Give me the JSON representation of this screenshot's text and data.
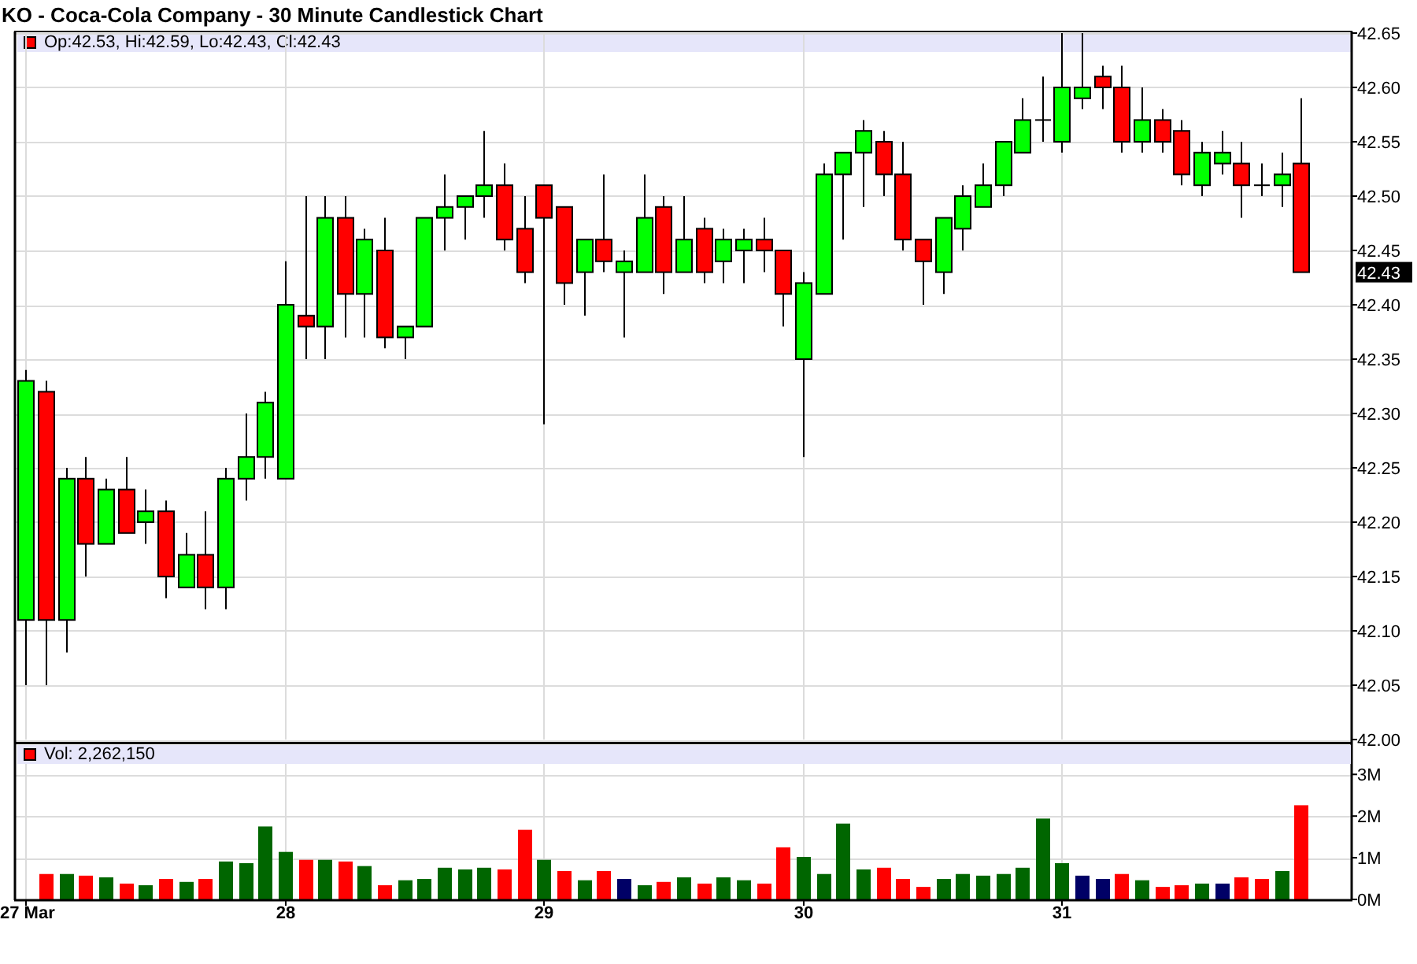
{
  "title": "KO - Coca-Cola Company - 30 Minute Candlestick Chart",
  "price_panel": {
    "legend": {
      "text": "Op:42.53, Hi:42.59, Lo:42.43, Cl:42.43",
      "color": "#ff0000"
    },
    "last_price": "42.43",
    "chart_data": {
      "type": "candlestick",
      "grid": true,
      "categories": [
        null,
        null,
        null,
        null,
        null,
        null,
        null,
        null,
        null,
        null,
        null,
        null,
        null,
        null,
        null,
        null,
        null,
        null,
        null,
        null,
        null,
        null,
        null,
        null,
        null,
        null,
        null,
        null,
        null,
        null,
        null,
        null,
        null,
        null,
        null,
        null,
        null,
        null,
        null,
        null,
        null,
        null,
        null,
        null,
        null,
        null,
        null,
        null,
        null,
        null,
        null,
        null,
        null,
        null,
        null,
        null,
        null,
        null,
        null,
        null,
        null,
        null,
        null,
        null,
        null,
        null,
        null
      ],
      "ylim": [
        42,
        42.65
      ],
      "yticks": [
        {
          "value": 42,
          "label": "42.00"
        },
        {
          "value": 42.05,
          "label": "42.05"
        },
        {
          "value": 42.1,
          "label": "42.10"
        },
        {
          "value": 42.15,
          "label": "42.15"
        },
        {
          "value": 42.2,
          "label": "42.20"
        },
        {
          "value": 42.25,
          "label": "42.25"
        },
        {
          "value": 42.3,
          "label": "42.30"
        },
        {
          "value": 42.35,
          "label": "42.35"
        },
        {
          "value": 42.4,
          "label": "42.40"
        },
        {
          "value": 42.45,
          "label": "42.45"
        },
        {
          "value": 42.5,
          "label": "42.50"
        },
        {
          "value": 42.55,
          "label": "42.55"
        },
        {
          "value": 42.6,
          "label": "42.60"
        },
        {
          "value": 42.65,
          "label": "42.65"
        }
      ],
      "ohlc": [
        [
          42.11,
          42.34,
          42.05,
          42.33
        ],
        [
          42.32,
          42.33,
          42.05,
          42.11
        ],
        [
          42.11,
          42.25,
          42.08,
          42.24
        ],
        [
          42.24,
          42.26,
          42.15,
          42.18
        ],
        [
          42.18,
          42.24,
          42.18,
          42.23
        ],
        [
          42.23,
          42.26,
          42.19,
          42.19
        ],
        [
          42.2,
          42.23,
          42.18,
          42.21
        ],
        [
          42.21,
          42.22,
          42.13,
          42.15
        ],
        [
          42.14,
          42.19,
          42.14,
          42.17
        ],
        [
          42.17,
          42.21,
          42.12,
          42.14
        ],
        [
          42.14,
          42.25,
          42.12,
          42.24
        ],
        [
          42.24,
          42.3,
          42.22,
          42.26
        ],
        [
          42.26,
          42.32,
          42.24,
          42.31
        ],
        [
          42.24,
          42.44,
          42.24,
          42.4
        ],
        [
          42.39,
          42.5,
          42.35,
          42.38
        ],
        [
          42.38,
          42.5,
          42.35,
          42.48
        ],
        [
          42.48,
          42.5,
          42.37,
          42.41
        ],
        [
          42.41,
          42.47,
          42.37,
          42.46
        ],
        [
          42.45,
          42.48,
          42.36,
          42.37
        ],
        [
          42.37,
          42.38,
          42.35,
          42.38
        ],
        [
          42.38,
          42.48,
          42.38,
          42.48
        ],
        [
          42.48,
          42.52,
          42.45,
          42.49
        ],
        [
          42.49,
          42.5,
          42.46,
          42.5
        ],
        [
          42.5,
          42.56,
          42.48,
          42.51
        ],
        [
          42.51,
          42.53,
          42.45,
          42.46
        ],
        [
          42.47,
          42.5,
          42.42,
          42.43
        ],
        [
          42.51,
          42.51,
          42.29,
          42.48
        ],
        [
          42.49,
          42.49,
          42.4,
          42.42
        ],
        [
          42.43,
          42.46,
          42.39,
          42.46
        ],
        [
          42.46,
          42.52,
          42.43,
          42.44
        ],
        [
          42.43,
          42.45,
          42.37,
          42.44
        ],
        [
          42.43,
          42.52,
          42.43,
          42.48
        ],
        [
          42.49,
          42.5,
          42.41,
          42.43
        ],
        [
          42.43,
          42.5,
          42.43,
          42.46
        ],
        [
          42.47,
          42.48,
          42.42,
          42.43
        ],
        [
          42.44,
          42.47,
          42.42,
          42.46
        ],
        [
          42.45,
          42.47,
          42.42,
          42.46
        ],
        [
          42.46,
          42.48,
          42.43,
          42.45
        ],
        [
          42.45,
          42.45,
          42.38,
          42.41
        ],
        [
          42.35,
          42.43,
          42.26,
          42.42
        ],
        [
          42.41,
          42.53,
          42.41,
          42.52
        ],
        [
          42.52,
          42.54,
          42.46,
          42.54
        ],
        [
          42.54,
          42.57,
          42.49,
          42.56
        ],
        [
          42.55,
          42.56,
          42.5,
          42.52
        ],
        [
          42.52,
          42.55,
          42.45,
          42.46
        ],
        [
          42.46,
          42.46,
          42.4,
          42.44
        ],
        [
          42.43,
          42.48,
          42.41,
          42.48
        ],
        [
          42.47,
          42.51,
          42.45,
          42.5
        ],
        [
          42.49,
          42.53,
          42.49,
          42.51
        ],
        [
          42.51,
          42.55,
          42.5,
          42.55
        ],
        [
          42.54,
          42.59,
          42.54,
          42.57
        ],
        [
          42.57,
          42.61,
          42.55,
          42.57
        ],
        [
          42.55,
          42.65,
          42.54,
          42.6
        ],
        [
          42.59,
          42.65,
          42.58,
          42.6
        ],
        [
          42.61,
          42.62,
          42.58,
          42.6
        ],
        [
          42.6,
          42.62,
          42.54,
          42.55
        ],
        [
          42.55,
          42.6,
          42.54,
          42.57
        ],
        [
          42.57,
          42.58,
          42.54,
          42.55
        ],
        [
          42.56,
          42.57,
          42.51,
          42.52
        ],
        [
          42.51,
          42.55,
          42.5,
          42.54
        ],
        [
          42.53,
          42.56,
          42.52,
          42.54
        ],
        [
          42.53,
          42.55,
          42.48,
          42.51
        ],
        [
          42.51,
          42.53,
          42.5,
          42.51
        ],
        [
          42.51,
          42.54,
          42.49,
          42.52
        ],
        [
          42.53,
          42.59,
          42.43,
          42.43
        ],
        null,
        null
      ]
    }
  },
  "volume_panel": {
    "legend": {
      "text": "Vol: 2,262,150",
      "color": "#ff0000"
    },
    "chart_data": {
      "type": "bar",
      "grid": true,
      "categories": [
        "27 Mar",
        null,
        null,
        null,
        null,
        null,
        null,
        null,
        null,
        null,
        null,
        null,
        null,
        "28",
        null,
        null,
        null,
        null,
        null,
        null,
        null,
        null,
        null,
        null,
        null,
        null,
        "29",
        null,
        null,
        null,
        null,
        null,
        null,
        null,
        null,
        null,
        null,
        null,
        null,
        "30",
        null,
        null,
        null,
        null,
        null,
        null,
        null,
        null,
        null,
        null,
        null,
        null,
        "31",
        null,
        null,
        null,
        null,
        null,
        null,
        null,
        null,
        null,
        null,
        null,
        null,
        null,
        null
      ],
      "ylim": [
        0,
        3.78
      ],
      "yticks": [
        {
          "value": 0,
          "label": "0M"
        },
        {
          "value": 1,
          "label": "1M"
        },
        {
          "value": 2,
          "label": "2M"
        },
        {
          "value": 3,
          "label": "3M"
        }
      ],
      "series": [
        {
          "color": "#006600",
          "values": [
            null,
            null,
            0.61,
            null,
            0.53,
            null,
            0.34,
            null,
            0.42,
            null,
            0.91,
            0.87,
            1.75,
            1.14,
            null,
            0.95,
            null,
            0.8,
            null,
            0.46,
            0.49,
            0.76,
            0.72,
            0.76,
            null,
            null,
            0.95,
            null,
            0.46,
            null,
            null,
            0.34,
            null,
            0.53,
            null,
            0.53,
            0.46,
            null,
            null,
            1.02,
            0.61,
            1.82,
            0.72,
            null,
            null,
            null,
            0.49,
            0.61,
            0.57,
            0.61,
            0.76,
            1.94,
            0.87,
            null,
            null,
            null,
            0.46,
            null,
            null,
            0.38,
            null,
            null,
            null,
            0.68,
            null,
            null,
            null
          ]
        },
        {
          "color": "#ff0000",
          "values": [
            null,
            0.61,
            null,
            0.57,
            null,
            0.38,
            null,
            0.49,
            null,
            0.49,
            null,
            null,
            null,
            null,
            0.95,
            null,
            0.91,
            null,
            0.34,
            null,
            null,
            null,
            null,
            null,
            0.72,
            1.67,
            null,
            0.68,
            null,
            0.68,
            null,
            null,
            0.42,
            null,
            0.38,
            null,
            null,
            0.38,
            1.25,
            null,
            null,
            null,
            null,
            0.76,
            0.49,
            0.3,
            null,
            null,
            null,
            null,
            null,
            null,
            null,
            null,
            null,
            0.61,
            null,
            0.3,
            0.34,
            null,
            null,
            0.53,
            0.49,
            null,
            2.26,
            null,
            null
          ]
        },
        {
          "color": "#000066",
          "values": [
            null,
            null,
            null,
            null,
            null,
            null,
            null,
            null,
            null,
            null,
            null,
            null,
            null,
            null,
            null,
            null,
            null,
            null,
            null,
            null,
            null,
            null,
            null,
            null,
            null,
            null,
            null,
            null,
            null,
            null,
            0.49,
            null,
            null,
            null,
            null,
            null,
            null,
            null,
            null,
            null,
            null,
            null,
            null,
            null,
            null,
            null,
            null,
            null,
            null,
            null,
            null,
            null,
            null,
            0.57,
            0.49,
            null,
            null,
            null,
            null,
            null,
            0.38,
            null,
            null,
            null,
            null,
            null,
            null
          ]
        }
      ]
    }
  }
}
